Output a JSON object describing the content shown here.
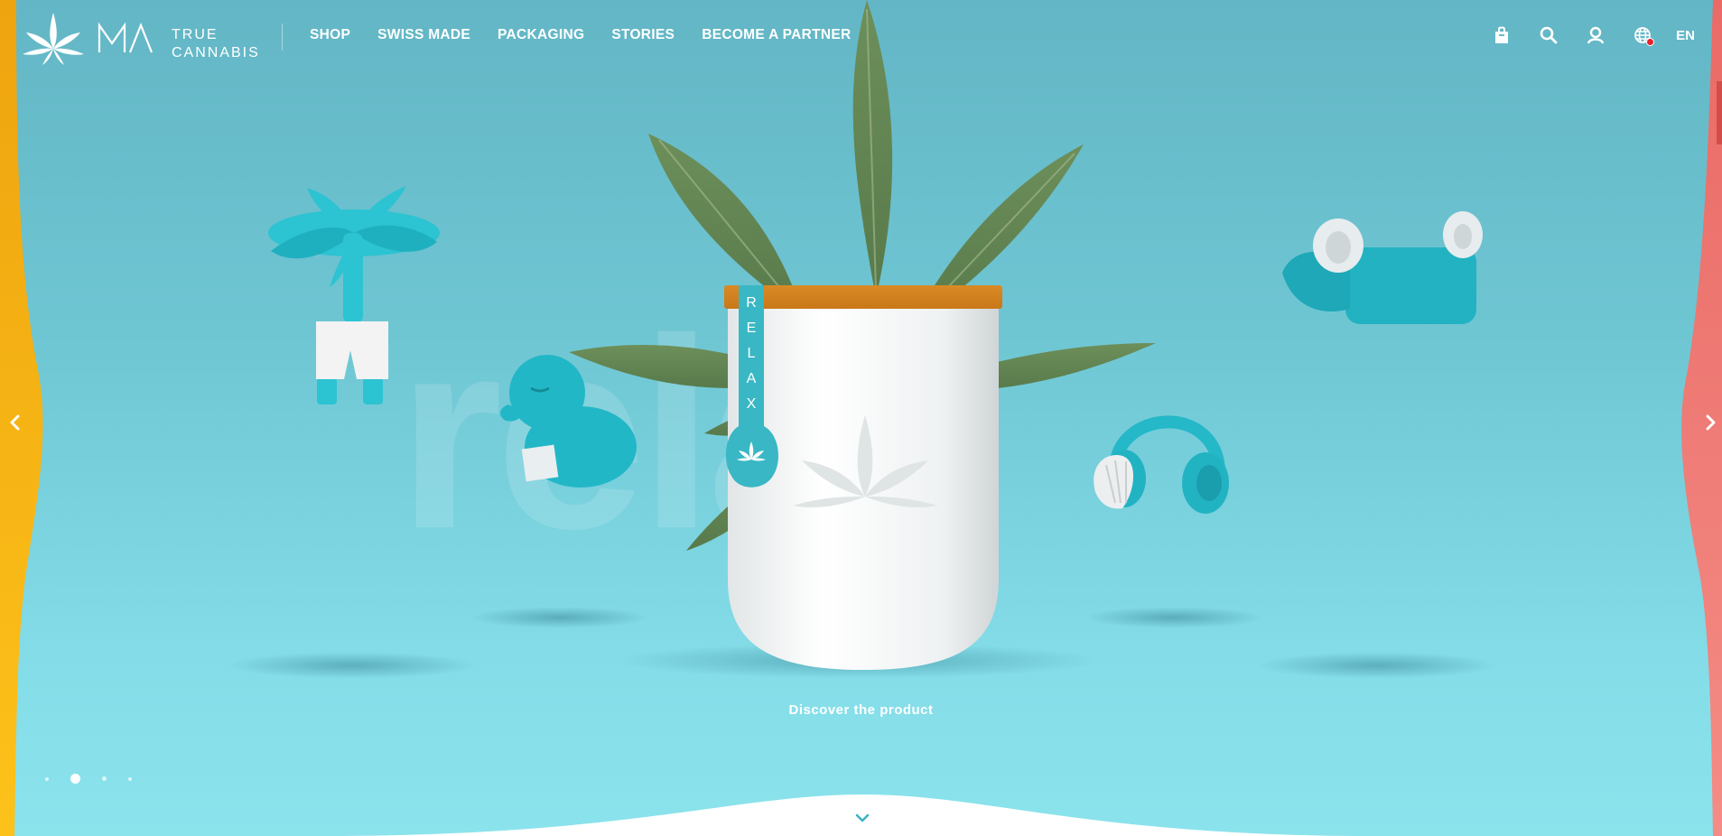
{
  "brand": {
    "mark": "MA",
    "line1": "TRUE",
    "line2": "CANNABIS"
  },
  "nav": {
    "items": [
      {
        "label": "SHOP"
      },
      {
        "label": "SWISS MADE"
      },
      {
        "label": "PACKAGING"
      },
      {
        "label": "STORIES"
      },
      {
        "label": "BECOME A PARTNER"
      }
    ]
  },
  "header_icons": [
    "bag-icon",
    "search-icon",
    "user-icon",
    "globe-icon"
  ],
  "language": "EN",
  "hero": {
    "watermark": "relax",
    "jar_label": [
      "R",
      "E",
      "L",
      "A",
      "X"
    ],
    "cta": "Discover the product",
    "slides_total": 4,
    "slide_active": 2
  },
  "colors": {
    "background_top": "#63b6c5",
    "background_bottom": "#8be3ec",
    "accent_teal": "#1fb6c6",
    "left_panel": "#f5b114",
    "right_panel": "#ef7f78",
    "lid_wood": "#e0922d"
  }
}
